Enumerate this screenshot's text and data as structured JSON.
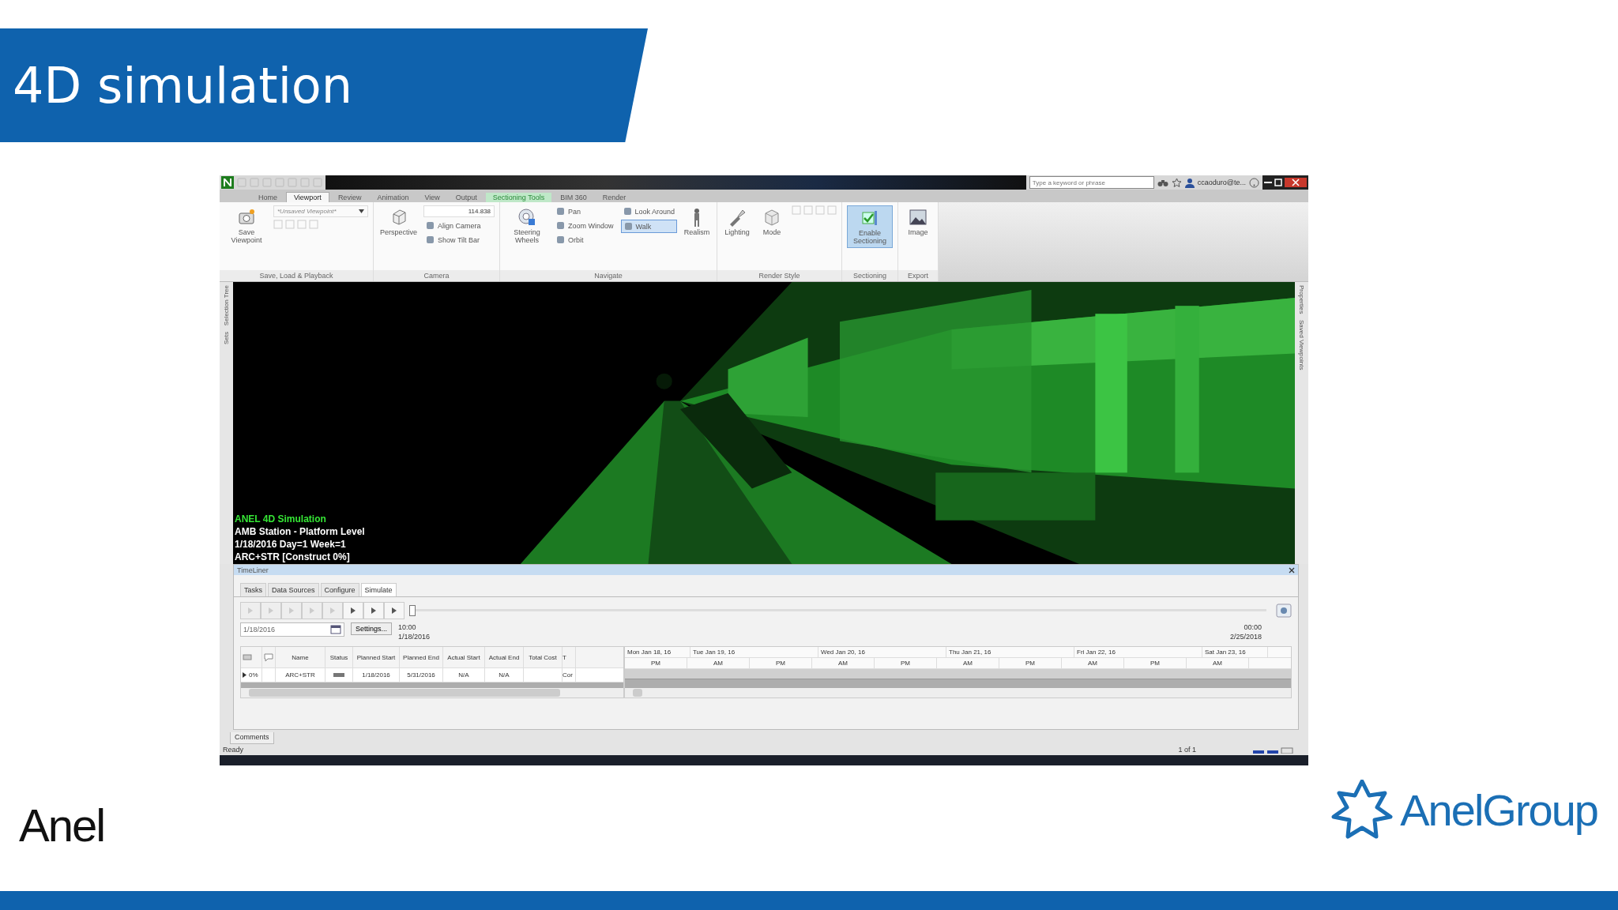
{
  "slide": {
    "title": "4D simulation",
    "logo_left": "Anel",
    "logo_right": "AnelGroup"
  },
  "app": {
    "search": {
      "placeholder": "Type a keyword or phrase"
    },
    "user": "ccaoduro@te...",
    "ribbon_tabs": [
      {
        "label": "Home",
        "selected": false,
        "kind": "normal"
      },
      {
        "label": "Viewport",
        "selected": true,
        "kind": "normal"
      },
      {
        "label": "Review",
        "selected": false,
        "kind": "normal"
      },
      {
        "label": "Animation",
        "selected": false,
        "kind": "normal"
      },
      {
        "label": "View",
        "selected": false,
        "kind": "normal"
      },
      {
        "label": "Output",
        "selected": false,
        "kind": "normal"
      },
      {
        "label": "Sectioning Tools",
        "selected": false,
        "kind": "contextual"
      },
      {
        "label": "BIM 360",
        "selected": false,
        "kind": "normal"
      },
      {
        "label": "Render",
        "selected": false,
        "kind": "normal"
      }
    ],
    "ribbon_panels": [
      {
        "label": "Save, Load & Playback",
        "groups": [
          {
            "tools": [
              {
                "kind": "large",
                "label": "Save Viewpoint",
                "selected": false
              }
            ]
          },
          {
            "tools": [
              {
                "kind": "dropdown",
                "label": "*Unsaved Viewpoint*",
                "selected": false
              },
              {
                "kind": "strip"
              }
            ]
          }
        ]
      },
      {
        "label": "Camera",
        "groups": [
          {
            "tools": [
              {
                "kind": "large",
                "label": "Perspective",
                "selected": false
              }
            ]
          },
          {
            "tools": [
              {
                "kind": "number",
                "label": "114.838",
                "selected": false
              },
              {
                "kind": "small",
                "label": "Align Camera",
                "selected": false
              },
              {
                "kind": "small",
                "label": "Show Tilt Bar",
                "selected": false
              }
            ]
          }
        ]
      },
      {
        "label": "Navigate",
        "groups": [
          {
            "tools": [
              {
                "kind": "large",
                "label": "Steering Wheels",
                "selected": false
              }
            ]
          },
          {
            "tools": [
              {
                "kind": "small",
                "label": "Pan",
                "selected": false
              },
              {
                "kind": "small",
                "label": "Zoom Window",
                "selected": false
              },
              {
                "kind": "small",
                "label": "Orbit",
                "selected": false
              }
            ]
          },
          {
            "tools": [
              {
                "kind": "small",
                "label": "Look Around",
                "selected": false
              },
              {
                "kind": "small",
                "label": "Walk",
                "selected": true
              }
            ]
          },
          {
            "tools": [
              {
                "kind": "large",
                "label": "Realism",
                "selected": false
              }
            ]
          }
        ]
      },
      {
        "label": "Render Style",
        "groups": [
          {
            "tools": [
              {
                "kind": "large",
                "label": "Lighting",
                "selected": false
              }
            ]
          },
          {
            "tools": [
              {
                "kind": "large",
                "label": "Mode",
                "selected": false
              }
            ]
          },
          {
            "tools": [
              {
                "kind": "strip"
              }
            ]
          }
        ]
      },
      {
        "label": "Sectioning",
        "groups": [
          {
            "tools": [
              {
                "kind": "large",
                "label": "Enable Sectioning",
                "selected": true
              }
            ]
          }
        ]
      },
      {
        "label": "Export",
        "groups": [
          {
            "tools": [
              {
                "kind": "large",
                "label": "Image",
                "selected": false
              }
            ]
          }
        ]
      }
    ],
    "side_tabs_left": [
      "Selection Tree",
      "Sets"
    ],
    "side_tabs_right": [
      "Properties",
      "Saved Viewpoints"
    ],
    "viewport": {
      "kind": "picture",
      "overlay": [
        {
          "text": "ANEL 4D Simulation",
          "kind": "heading"
        },
        {
          "text": "AMB Station - Platform Level",
          "kind": "line"
        },
        {
          "text": "1/18/2016 Day=1 Week=1",
          "kind": "line"
        },
        {
          "text": "ARC+STR [Construct 0%]",
          "kind": "line"
        }
      ]
    },
    "timeliner": {
      "title": "TimeLiner",
      "tabs": [
        {
          "label": "Tasks",
          "selected": false
        },
        {
          "label": "Data Sources",
          "selected": false
        },
        {
          "label": "Configure",
          "selected": false
        },
        {
          "label": "Simulate",
          "selected": true
        }
      ],
      "playback_buttons": [
        {
          "disabled": true
        },
        {
          "disabled": true
        },
        {
          "disabled": true
        },
        {
          "disabled": true
        },
        {
          "disabled": true
        },
        {
          "disabled": false
        },
        {
          "disabled": false
        },
        {
          "disabled": false
        }
      ],
      "slider": {
        "level": 0
      },
      "date_field": {
        "value": "1/18/2016"
      },
      "settings_button": "Settings...",
      "start_time": "10:00",
      "start_date": "1/18/2016",
      "end_time": "00:00",
      "end_date": "2/25/2018",
      "columns": [
        "Name",
        "Status",
        "Planned Start",
        "Planned End",
        "Actual Start",
        "Actual End",
        "Total Cost",
        "T"
      ],
      "rows": [
        {
          "progress": "0%",
          "name": "ARC+STR",
          "planned_start": "1/18/2016",
          "planned_end": "5/31/2016",
          "actual_start": "N/A",
          "actual_end": "N/A",
          "type": "Cor"
        }
      ],
      "gantt_days": [
        {
          "label": "Mon Jan 18, 16",
          "halves": [
            "PM"
          ]
        },
        {
          "label": "Tue Jan 19, 16",
          "halves": [
            "AM",
            "PM"
          ]
        },
        {
          "label": "Wed Jan 20, 16",
          "halves": [
            "AM",
            "PM"
          ]
        },
        {
          "label": "Thu Jan 21, 16",
          "halves": [
            "AM",
            "PM"
          ]
        },
        {
          "label": "Fri Jan 22, 16",
          "halves": [
            "AM",
            "PM"
          ]
        },
        {
          "label": "Sat Jan 23, 16",
          "halves": [
            "AM"
          ]
        }
      ]
    },
    "comments_tab": "Comments",
    "status": "Ready",
    "page_indicator": "1 of 1"
  }
}
